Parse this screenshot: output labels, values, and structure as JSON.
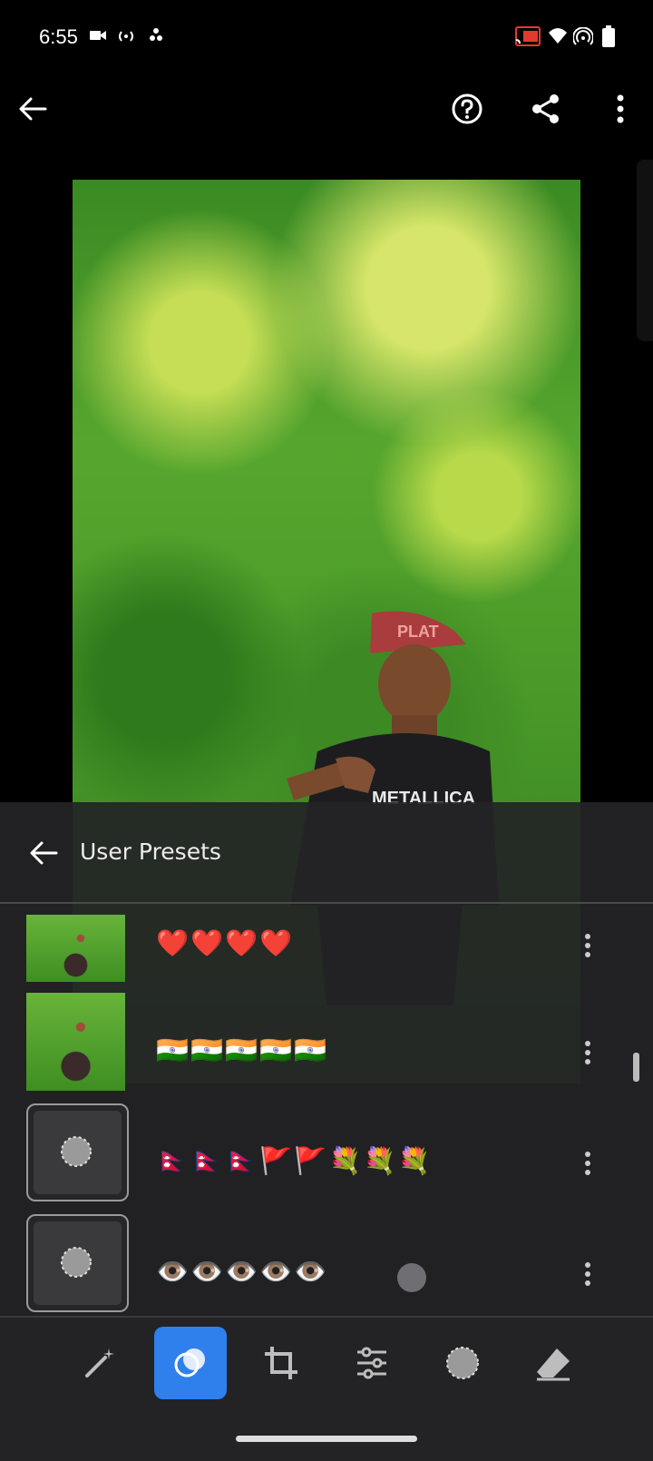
{
  "status_bar": {
    "time": "6:55",
    "icons_left": [
      "video-icon",
      "broadcast-icon",
      "fan-icon"
    ],
    "icons_right": [
      "cast-icon",
      "wifi-icon",
      "hotspot-icon",
      "battery-icon"
    ]
  },
  "top_bar": {
    "back_icon": "arrow-left-icon",
    "help_icon": "help-icon",
    "share_icon": "share-icon",
    "more_icon": "more-vert-icon"
  },
  "photo": {
    "cap_text": "PLAT",
    "shirt_text": "METALLICA"
  },
  "panel": {
    "title": "User Presets",
    "presets": [
      {
        "name": "❤️❤️❤️❤️",
        "thumb": "photo"
      },
      {
        "name": "🇮🇳🇮🇳🇮🇳🇮🇳🇮🇳",
        "thumb": "photo"
      },
      {
        "name": "🇳🇵🇳🇵🇳🇵🚩🚩💐💐💐",
        "thumb": "empty"
      },
      {
        "name": "👁️👁️👁️👁️👁️",
        "thumb": "empty"
      }
    ]
  },
  "toolbar": {
    "tools": [
      "magic-wand-icon",
      "presets-icon",
      "crop-icon",
      "adjust-icon",
      "vignette-icon",
      "eraser-icon"
    ],
    "active_index": 1
  }
}
